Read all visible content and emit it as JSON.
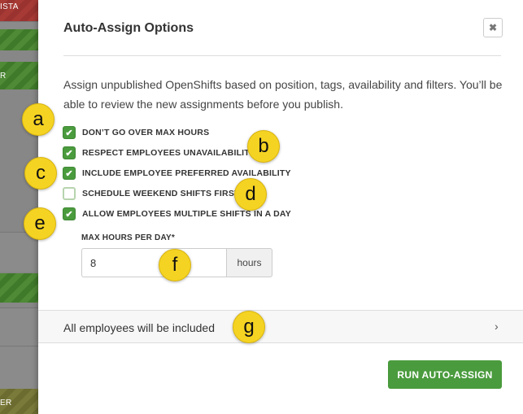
{
  "background": {
    "row_tags": [
      "ISTA",
      "R",
      "ER"
    ]
  },
  "dialog": {
    "title": "Auto-Assign Options",
    "close_icon": "close-icon",
    "description": "Assign unpublished OpenShifts based on position, tags, availability and filters. You’ll be able to review the new assignments before you publish.",
    "options": [
      {
        "label": "DON’T GO OVER MAX HOURS",
        "checked": true
      },
      {
        "label": "RESPECT EMPLOYEES UNAVAILABILITY",
        "checked": true
      },
      {
        "label": "INCLUDE EMPLOYEE PREFERRED AVAILABILITY",
        "checked": true
      },
      {
        "label": "SCHEDULE WEEKEND SHIFTS FIRST",
        "checked": false
      },
      {
        "label": "ALLOW EMPLOYEES MULTIPLE SHIFTS IN A DAY",
        "checked": true
      }
    ],
    "max_hours": {
      "label": "MAX HOURS PER DAY*",
      "value": "8",
      "unit": "hours"
    },
    "filter": {
      "text": "All employees will be included",
      "chevron_icon": "chevron-right-icon"
    },
    "run_button": "RUN AUTO-ASSIGN"
  },
  "callouts": [
    "a",
    "b",
    "c",
    "d",
    "e",
    "f",
    "g"
  ],
  "colors": {
    "accent_green": "#4a9b3d",
    "callout_yellow": "#f5d322"
  }
}
